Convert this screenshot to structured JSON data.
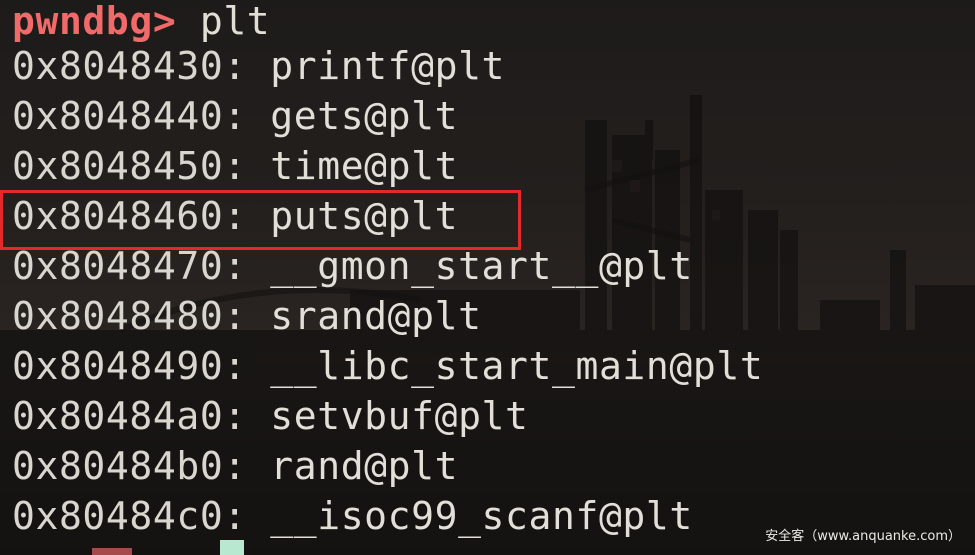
{
  "terminal": {
    "prompt_label": "pwndbg>",
    "command": " plt",
    "entries": [
      {
        "addr": "0x8048430:",
        "symbol": " printf@plt"
      },
      {
        "addr": "0x8048440:",
        "symbol": " gets@plt"
      },
      {
        "addr": "0x8048450:",
        "symbol": " time@plt"
      },
      {
        "addr": "0x8048460:",
        "symbol": " puts@plt"
      },
      {
        "addr": "0x8048470:",
        "symbol": " __gmon_start__@plt"
      },
      {
        "addr": "0x8048480:",
        "symbol": " srand@plt"
      },
      {
        "addr": "0x8048490:",
        "symbol": " __libc_start_main@plt"
      },
      {
        "addr": "0x80484a0:",
        "symbol": " setvbuf@plt"
      },
      {
        "addr": "0x80484b0:",
        "symbol": " rand@plt"
      },
      {
        "addr": "0x80484c0:",
        "symbol": " __isoc99_scanf@plt"
      }
    ],
    "highlighted_entry": "puts@plt"
  },
  "watermark": "安全客（www.anquanke.com）",
  "colors": {
    "prompt": "#f06a6a",
    "text": "#d8d6cf",
    "highlight_border": "#e22a2a",
    "cursor": "#b9e8d0",
    "background": "#1b1a19"
  }
}
